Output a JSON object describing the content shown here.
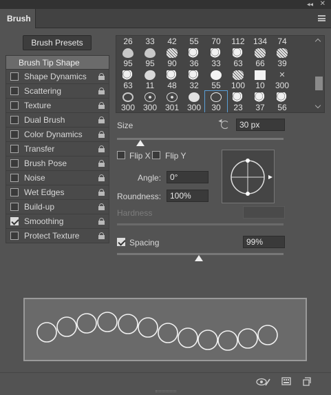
{
  "panel": {
    "tab_label": "Brush",
    "collapse_glyph": "◂◂",
    "close_glyph": "✕",
    "menu_icon": "hamburger-menu-icon"
  },
  "brush_presets_button": "Brush Presets",
  "sidebar": {
    "header": "Brush Tip Shape",
    "items": [
      {
        "label": "Shape Dynamics",
        "checked": false
      },
      {
        "label": "Scattering",
        "checked": false
      },
      {
        "label": "Texture",
        "checked": false
      },
      {
        "label": "Dual Brush",
        "checked": false
      },
      {
        "label": "Color Dynamics",
        "checked": false
      },
      {
        "label": "Transfer",
        "checked": false
      },
      {
        "label": "Brush Pose",
        "checked": false
      },
      {
        "label": "Noise",
        "checked": false
      },
      {
        "label": "Wet Edges",
        "checked": false
      },
      {
        "label": "Build-up",
        "checked": false
      },
      {
        "label": "Smoothing",
        "checked": true
      },
      {
        "label": "Protect Texture",
        "checked": false
      }
    ]
  },
  "brush_grid": {
    "top_row_numbers": [
      "26",
      "33",
      "42",
      "55",
      "70",
      "112",
      "134",
      "74"
    ],
    "rows": [
      [
        {
          "n": "95",
          "icon": "drop"
        },
        {
          "n": "95",
          "icon": "drop"
        },
        {
          "n": "90",
          "icon": "texture"
        },
        {
          "n": "36",
          "icon": "blob"
        },
        {
          "n": "33",
          "icon": "blob"
        },
        {
          "n": "63",
          "icon": "blob"
        },
        {
          "n": "66",
          "icon": "texture"
        },
        {
          "n": "39",
          "icon": "texture"
        }
      ],
      [
        {
          "n": "63",
          "icon": "blob"
        },
        {
          "n": "11",
          "icon": "leaf"
        },
        {
          "n": "48",
          "icon": "blob"
        },
        {
          "n": "32",
          "icon": "blob"
        },
        {
          "n": "55",
          "icon": "hard"
        },
        {
          "n": "100",
          "icon": "texture"
        },
        {
          "n": "10",
          "icon": "square"
        },
        {
          "n": "300",
          "icon": "star"
        }
      ],
      [
        {
          "n": "300",
          "icon": "ring"
        },
        {
          "n": "300",
          "icon": "ring2"
        },
        {
          "n": "301",
          "icon": "ring2"
        },
        {
          "n": "300",
          "icon": "dot"
        },
        {
          "n": "30",
          "icon": "circle-big",
          "selected": true
        },
        {
          "n": "23",
          "icon": "blob"
        },
        {
          "n": "37",
          "icon": "blob"
        },
        {
          "n": "56",
          "icon": "blob"
        }
      ]
    ]
  },
  "tip": {
    "size_label": "Size",
    "size_value": "30 px",
    "size_fraction": 0.14,
    "flip_x_label": "Flip X",
    "flip_y_label": "Flip Y",
    "flip_x_checked": false,
    "flip_y_checked": false,
    "angle_label": "Angle:",
    "angle_value": "0°",
    "roundness_label": "Roundness:",
    "roundness_value": "100%",
    "hardness_label": "Hardness",
    "hardness_value": "",
    "spacing_label": "Spacing",
    "spacing_checked": true,
    "spacing_value": "99%",
    "spacing_fraction": 0.49
  },
  "footer": {
    "icons": [
      "eye-brush-icon",
      "create-brush-icon",
      "new-preset-icon"
    ]
  },
  "colors": {
    "panel_bg": "#535353",
    "accent_selected": "#5aa0d8"
  }
}
